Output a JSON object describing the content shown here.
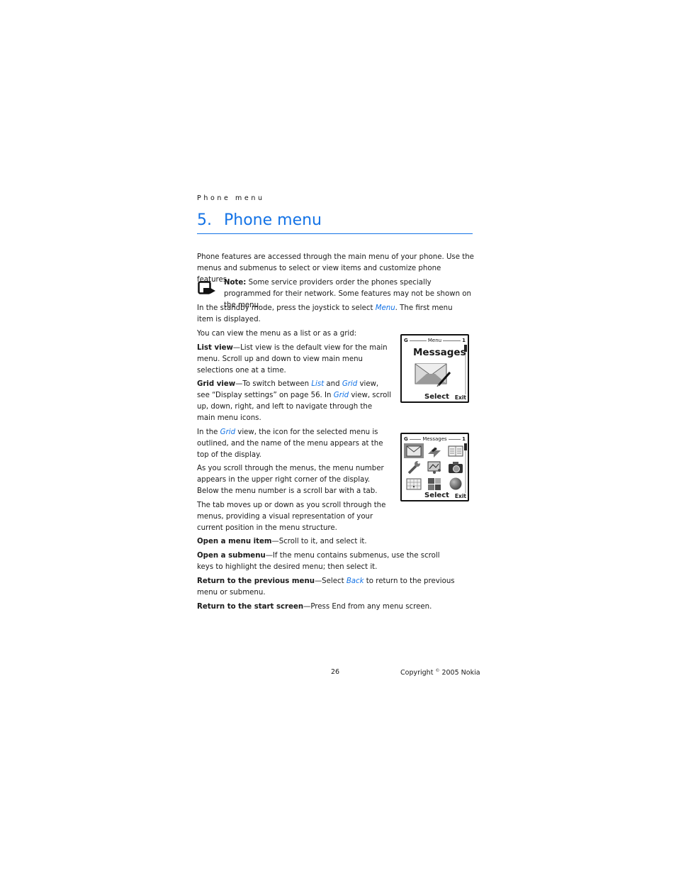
{
  "running_head": "Phone menu",
  "chapter": {
    "number": "5.",
    "title": "Phone menu"
  },
  "intro": "Phone features are accessed through the main menu of your phone. Use the menus and submenus to select or view items and customize phone features.",
  "note": {
    "icon": "note-hand-icon",
    "label": "Note:",
    "text": " Some service providers order the phones specially programmed for their network. Some features may not be shown on the menu."
  },
  "standby": {
    "before": "In the standby mode, press the joystick to select ",
    "link": "Menu",
    "after": ". The first menu item is displayed."
  },
  "view_intro": "You can view the menu as a list or as a grid:",
  "list_view": {
    "label": "List view",
    "text": "—List view is the default view for the main menu. Scroll up and down to view main menu selections one at a time."
  },
  "grid_view": {
    "label": "Grid view",
    "t1": "—To switch between ",
    "link1": "List",
    "t2": " and ",
    "link2": "Grid",
    "t3": " view, see “Display settings” on page 56. In ",
    "link3": "Grid",
    "t4": " view, scroll up, down, right, and left to navigate through the main menu icons."
  },
  "grid_para": {
    "t1": "In the ",
    "link": "Grid",
    "t2": " view, the icon for the selected menu is outlined, and the name of the menu appears at the top of the display."
  },
  "scroll_para": "As you scroll through the menus, the menu number appears in the upper right corner of the display. Below the menu number is a scroll bar with a tab.",
  "tab_para": "The tab moves up or down as you scroll through the menus, providing a visual representation of your current position in the menu structure.",
  "open_item": {
    "label": "Open a menu item",
    "text": "—Scroll to it, and select it."
  },
  "open_submenu": {
    "label": "Open a submenu",
    "text": "—If the menu contains submenus, use the scroll keys to highlight the desired menu; then select it."
  },
  "return_prev": {
    "label": "Return to the previous menu",
    "t1": "—Select ",
    "link": "Back",
    "t2": " to return to the previous menu or submenu."
  },
  "return_start": {
    "label": "Return to the start screen",
    "text": "—Press End from any menu screen."
  },
  "phone_list": {
    "signal": "G",
    "header": "Menu",
    "menu_number": "1",
    "title": "Messages",
    "left_softkey": "Select",
    "right_softkey": "Exit",
    "icon": "envelope-with-pen-icon"
  },
  "phone_grid": {
    "signal": "G",
    "header": "Messages",
    "menu_number": "1",
    "left_softkey": "Select",
    "right_softkey": "Exit",
    "icons": [
      "envelope-icon",
      "call-arrows-icon",
      "contacts-book-icon",
      "wrench-icon",
      "gallery-icon",
      "camera-icon",
      "calendar-icon",
      "apps-blocks-icon",
      "globe-icon"
    ],
    "selected_index": 0
  },
  "footer": {
    "page": "26",
    "copyright_pre": "Copyright ",
    "copyright_sym": "©",
    "copyright_post": " 2005 Nokia"
  },
  "colors": {
    "accent": "#1473e6",
    "text": "#1a1a1a"
  }
}
